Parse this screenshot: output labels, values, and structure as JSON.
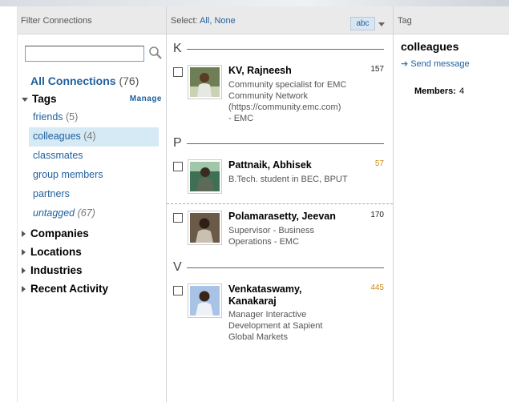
{
  "filter_panel": {
    "header": "Filter Connections",
    "search_placeholder": "",
    "all_connections_label": "All Connections",
    "all_connections_count": "(76)",
    "tags_label": "Tags",
    "manage_label": "Manage",
    "tags": [
      {
        "label": "friends",
        "count": "(5)"
      },
      {
        "label": "colleagues",
        "count": "(4)"
      },
      {
        "label": "classmates",
        "count": ""
      },
      {
        "label": "group members",
        "count": ""
      },
      {
        "label": "partners",
        "count": ""
      },
      {
        "label": "untagged",
        "count": "(67)"
      }
    ],
    "sections": [
      "Companies",
      "Locations",
      "Industries",
      "Recent Activity"
    ]
  },
  "list_panel": {
    "select_label": "Select:",
    "select_all": "All,",
    "select_none": "None",
    "sort_label": "abc",
    "letters": [
      "K",
      "P",
      "V"
    ],
    "connections": [
      {
        "name": "KV, Rajneesh",
        "count": "157",
        "info": [
          "Community specialist for EMC",
          "Community Network",
          "(https://community.emc.com)",
          "- EMC"
        ]
      },
      {
        "name": "Pattnaik, Abhisek",
        "count": "57",
        "info": [
          "B.Tech. student in BEC, BPUT"
        ]
      },
      {
        "name": "Polamarasetty, Jeevan",
        "count": "170",
        "info": [
          "Supervisor - Business",
          "Operations - EMC"
        ]
      },
      {
        "name": "Venkataswamy,",
        "name2": "Kanakaraj",
        "count": "445",
        "info": [
          "Manager Interactive",
          "Development at Sapient",
          "Global Markets"
        ]
      }
    ]
  },
  "tag_panel": {
    "header": "Tag",
    "tag_name": "colleagues",
    "send_message": "Send message",
    "members_label": "Members:",
    "members_count": "4"
  },
  "colors": {
    "link": "#1f5f9e",
    "highlight": "#d6eaf6",
    "gold": "#d08a1a"
  }
}
